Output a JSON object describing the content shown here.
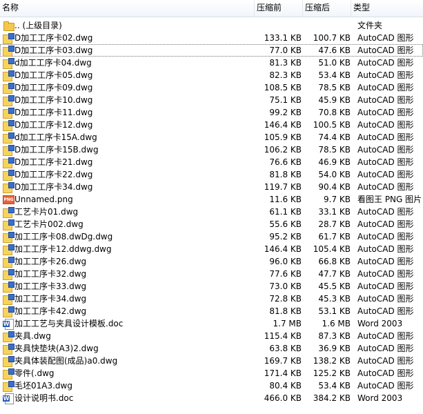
{
  "columns": {
    "name": "名称",
    "before": "压缩前",
    "after": "压缩后",
    "type": "类型"
  },
  "files": [
    {
      "name": ".. (上级目录)",
      "before": "",
      "after": "",
      "type": "文件夹",
      "icon": "folder-icon"
    },
    {
      "name": "D加工工序卡02.dwg",
      "before": "133.1 KB",
      "after": "100.7 KB",
      "type": "AutoCAD 图形",
      "icon": "dwg-icon"
    },
    {
      "name": "D加工工序卡03.dwg",
      "before": "77.0 KB",
      "after": "47.6 KB",
      "type": "AutoCAD 图形",
      "icon": "dwg-icon"
    },
    {
      "name": "d加工工序卡04.dwg",
      "before": "81.3 KB",
      "after": "51.0 KB",
      "type": "AutoCAD 图形",
      "icon": "dwg-icon"
    },
    {
      "name": "D加工工序卡05.dwg",
      "before": "82.3 KB",
      "after": "53.4 KB",
      "type": "AutoCAD 图形",
      "icon": "dwg-icon"
    },
    {
      "name": "D加工工序卡09.dwg",
      "before": "108.5 KB",
      "after": "78.5 KB",
      "type": "AutoCAD 图形",
      "icon": "dwg-icon"
    },
    {
      "name": "D加工工序卡10.dwg",
      "before": "75.1 KB",
      "after": "45.9 KB",
      "type": "AutoCAD 图形",
      "icon": "dwg-icon"
    },
    {
      "name": "D加工工序卡11.dwg",
      "before": "99.2 KB",
      "after": "70.8 KB",
      "type": "AutoCAD 图形",
      "icon": "dwg-icon"
    },
    {
      "name": "D加工工序卡12.dwg",
      "before": "146.4 KB",
      "after": "100.5 KB",
      "type": "AutoCAD 图形",
      "icon": "dwg-icon"
    },
    {
      "name": "d加工工序卡15A.dwg",
      "before": "105.9 KB",
      "after": "74.4 KB",
      "type": "AutoCAD 图形",
      "icon": "dwg-icon"
    },
    {
      "name": "D加工工序卡15B.dwg",
      "before": "106.2 KB",
      "after": "78.5 KB",
      "type": "AutoCAD 图形",
      "icon": "dwg-icon"
    },
    {
      "name": "D加工工序卡21.dwg",
      "before": "76.6 KB",
      "after": "46.9 KB",
      "type": "AutoCAD 图形",
      "icon": "dwg-icon"
    },
    {
      "name": "D加工工序卡22.dwg",
      "before": "81.8 KB",
      "after": "54.0 KB",
      "type": "AutoCAD 图形",
      "icon": "dwg-icon"
    },
    {
      "name": "D加工工序卡34.dwg",
      "before": "119.7 KB",
      "after": "90.4 KB",
      "type": "AutoCAD 图形",
      "icon": "dwg-icon"
    },
    {
      "name": "Unnamed.png",
      "before": "11.6 KB",
      "after": "9.7 KB",
      "type": "看图王 PNG 图片",
      "icon": "png-icon"
    },
    {
      "name": "工艺卡片01.dwg",
      "before": "61.1 KB",
      "after": "33.1 KB",
      "type": "AutoCAD 图形",
      "icon": "dwg-icon"
    },
    {
      "name": "工艺卡片002.dwg",
      "before": "55.6 KB",
      "after": "28.7 KB",
      "type": "AutoCAD 图形",
      "icon": "dwg-icon"
    },
    {
      "name": "加工工序卡08.dwDg.dwg",
      "before": "95.2 KB",
      "after": "61.7 KB",
      "type": "AutoCAD 图形",
      "icon": "dwg-icon"
    },
    {
      "name": "加工工序卡12.ddwg.dwg",
      "before": "146.4 KB",
      "after": "105.4 KB",
      "type": "AutoCAD 图形",
      "icon": "dwg-icon"
    },
    {
      "name": "加工工序卡26.dwg",
      "before": "96.0 KB",
      "after": "66.8 KB",
      "type": "AutoCAD 图形",
      "icon": "dwg-icon"
    },
    {
      "name": "加工工序卡32.dwg",
      "before": "77.6 KB",
      "after": "47.7 KB",
      "type": "AutoCAD 图形",
      "icon": "dwg-icon"
    },
    {
      "name": "加工工序卡33.dwg",
      "before": "73.0 KB",
      "after": "45.5 KB",
      "type": "AutoCAD 图形",
      "icon": "dwg-icon"
    },
    {
      "name": "加工工序卡34.dwg",
      "before": "72.8 KB",
      "after": "45.3 KB",
      "type": "AutoCAD 图形",
      "icon": "dwg-icon"
    },
    {
      "name": "加工工序卡42.dwg",
      "before": "81.8 KB",
      "after": "53.1 KB",
      "type": "AutoCAD 图形",
      "icon": "dwg-icon"
    },
    {
      "name": "加工工艺与夹具设计模板.doc",
      "before": "1.7 MB",
      "after": "1.6 MB",
      "type": "Word 2003",
      "icon": "doc-icon"
    },
    {
      "name": "夹具.dwg",
      "before": "115.4 KB",
      "after": "87.3 KB",
      "type": "AutoCAD 图形",
      "icon": "dwg-icon"
    },
    {
      "name": "夹具快垫块(A3)2.dwg",
      "before": "63.8 KB",
      "after": "36.9 KB",
      "type": "AutoCAD 图形",
      "icon": "dwg-icon"
    },
    {
      "name": "夹具体装配图(成品)a0.dwg",
      "before": "169.7 KB",
      "after": "138.2 KB",
      "type": "AutoCAD 图形",
      "icon": "dwg-icon"
    },
    {
      "name": "零件(.dwg",
      "before": "171.4 KB",
      "after": "125.2 KB",
      "type": "AutoCAD 图形",
      "icon": "dwg-icon"
    },
    {
      "name": "毛坯01A3.dwg",
      "before": "80.4 KB",
      "after": "53.4 KB",
      "type": "AutoCAD 图形",
      "icon": "dwg-icon"
    },
    {
      "name": "设计说明书.doc",
      "before": "466.0 KB",
      "after": "384.2 KB",
      "type": "Word 2003",
      "icon": "doc-icon"
    }
  ]
}
